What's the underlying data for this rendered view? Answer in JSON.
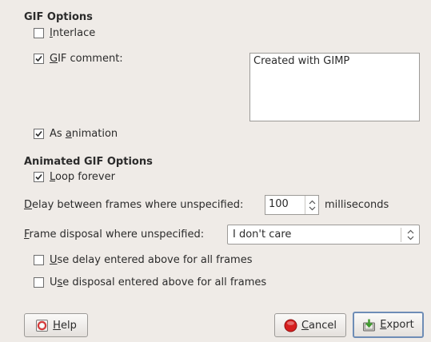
{
  "gif_options": {
    "heading": "GIF Options",
    "interlace": {
      "label_u": "I",
      "label_rest": "nterlace",
      "checked": false
    },
    "gif_comment": {
      "label_u": "G",
      "label_rest": "IF comment:",
      "checked": true,
      "value": "Created with GIMP"
    },
    "as_animation": {
      "label_pre": "As ",
      "label_u": "a",
      "label_rest": "nimation",
      "checked": true
    }
  },
  "animated_options": {
    "heading": "Animated GIF Options",
    "loop_forever": {
      "label_u": "L",
      "label_rest": "oop forever",
      "checked": true
    },
    "delay": {
      "label_u": "D",
      "label_rest": "elay between frames where unspecified:",
      "value": "100",
      "unit": "milliseconds"
    },
    "disposal": {
      "label_u": "F",
      "label_rest": "rame disposal where unspecified:",
      "value": "I don't care"
    },
    "use_delay": {
      "label_u": "U",
      "label_rest": "se delay entered above for all frames",
      "checked": false
    },
    "use_disposal": {
      "label_pre": "U",
      "label_u": "s",
      "label_rest": "e disposal entered above for all frames",
      "checked": false
    }
  },
  "buttons": {
    "help": {
      "label_u": "H",
      "label_rest": "elp",
      "icon": "help-icon"
    },
    "cancel": {
      "label_u": "C",
      "label_rest": "ancel",
      "icon": "cancel-icon"
    },
    "export": {
      "label_u": "E",
      "label_rest": "xport",
      "icon": "export-icon"
    }
  }
}
